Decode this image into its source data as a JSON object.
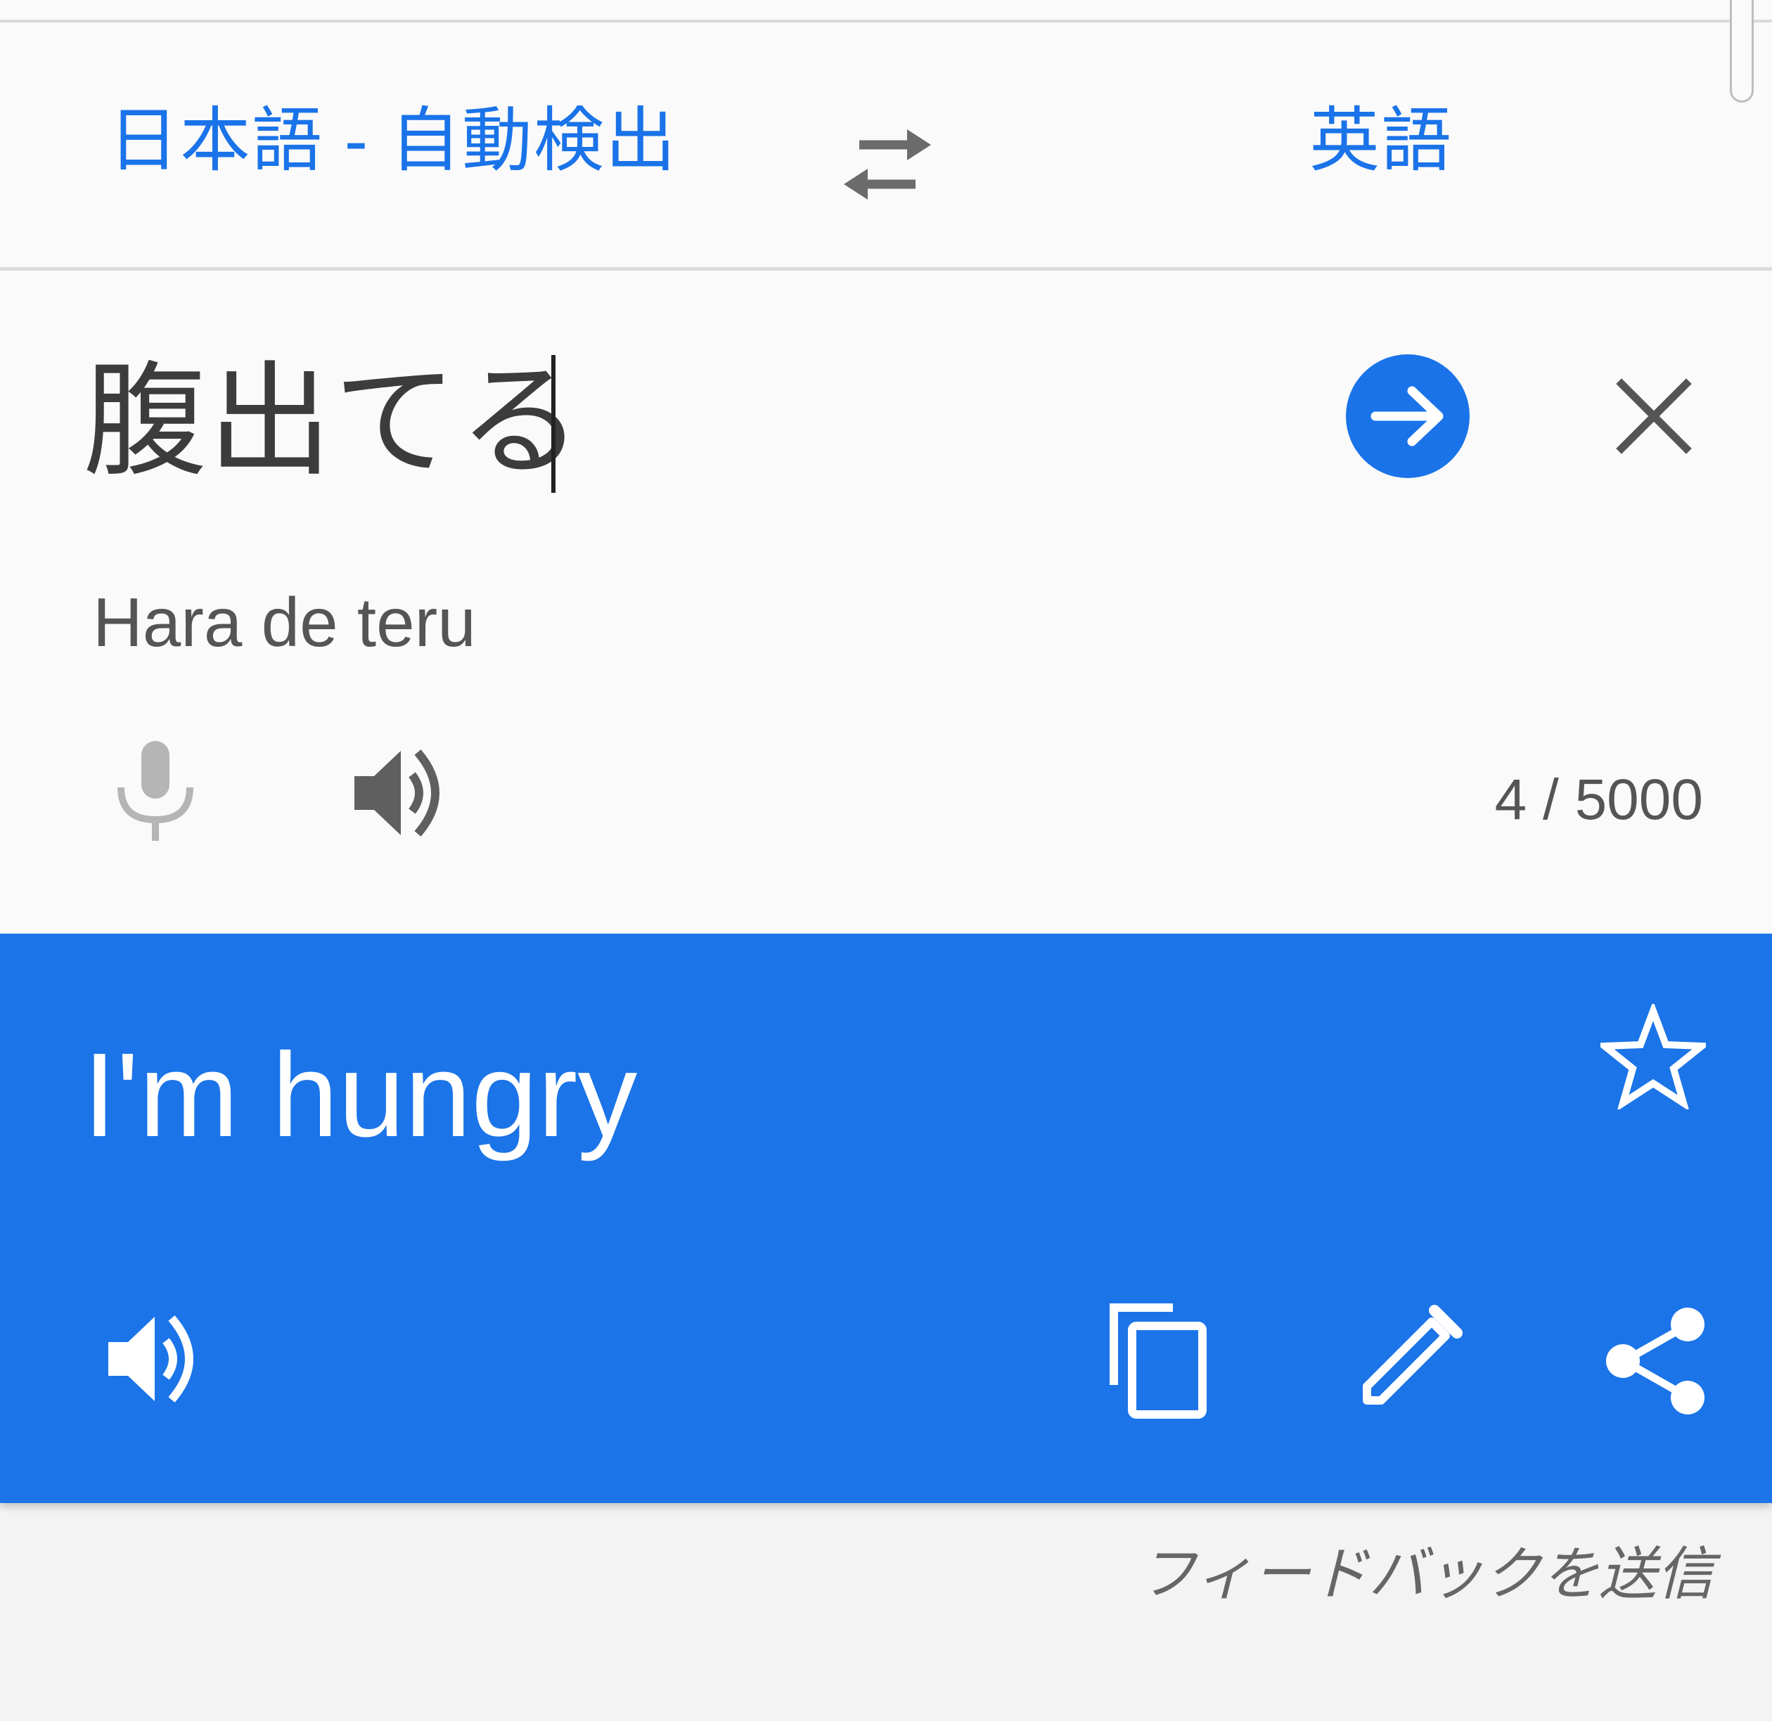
{
  "header": {
    "source_language": "日本語 - 自動検出",
    "target_language": "英語",
    "swap_icon": "swap-horiz-icon"
  },
  "input": {
    "text": "腹出てる",
    "transliteration": "Hara de teru",
    "char_count": "4 / 5000",
    "go_icon": "arrow-forward-icon",
    "clear_icon": "close-icon",
    "mic_icon": "mic-icon",
    "speaker_icon": "volume-up-icon"
  },
  "result": {
    "text": "I'm hungry",
    "star_icon": "star-outline-icon",
    "speaker_icon": "volume-up-icon",
    "copy_icon": "copy-icon",
    "edit_icon": "edit-icon",
    "share_icon": "share-icon"
  },
  "footer": {
    "feedback_label": "フィードバックを送信"
  },
  "colors": {
    "accent": "#1a73e8",
    "result_background": "#1b74e8",
    "page_background": "#f3f3f3",
    "card_background": "#fafafa"
  }
}
